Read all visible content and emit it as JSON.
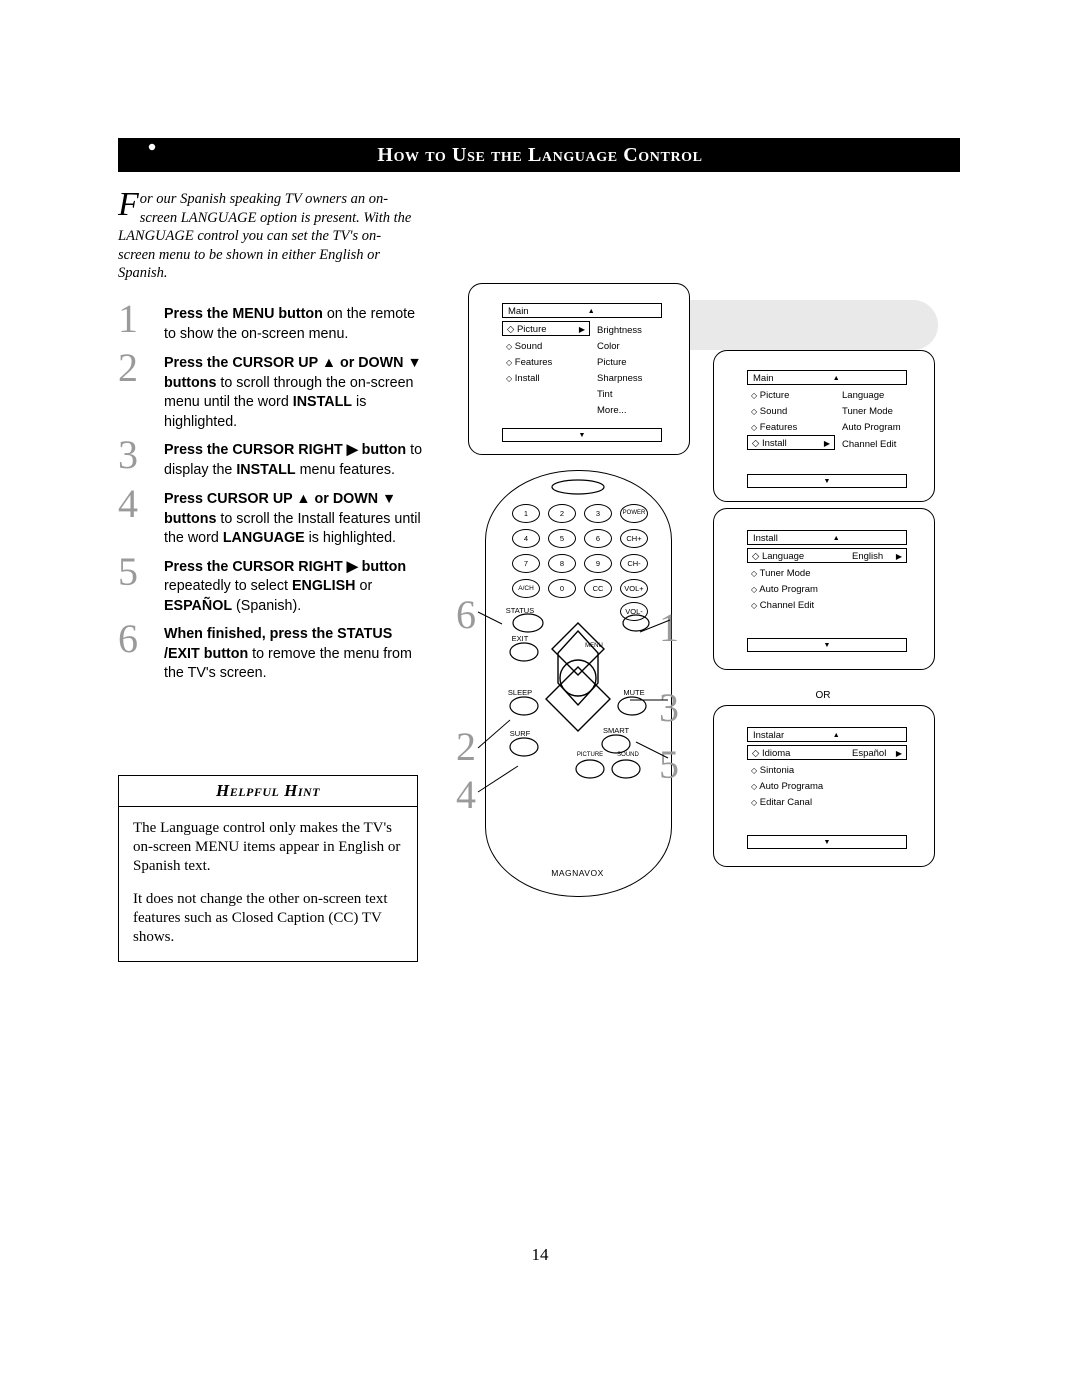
{
  "header": {
    "title": "How to Use the Language Control",
    "icon": "remote-control-icon"
  },
  "intro": {
    "dropcap": "F",
    "text": "or our Spanish speaking TV owners an on-screen LANGUAGE option is present. With the LANGUAGE control you can set the TV's on-screen menu to be shown in either English or Spanish."
  },
  "steps": [
    {
      "num": "1",
      "html": "<b>Press the MENU button</b> on the remote to show the on-screen menu."
    },
    {
      "num": "2",
      "html": "<b>Press the CURSOR UP ▲ or DOWN ▼ buttons</b> to scroll through the on-screen menu until the word <b>INSTALL</b> is highlighted."
    },
    {
      "num": "3",
      "html": "<b>Press the CURSOR RIGHT ▶ button</b> to display the <b>INSTALL</b> menu features."
    },
    {
      "num": "4",
      "html": "<b>Press CURSOR UP ▲ or DOWN ▼ buttons</b> to scroll the Install features until the word <b>LANGUAGE</b> is highlighted."
    },
    {
      "num": "5",
      "html": "<b>Press the CURSOR RIGHT ▶ button</b> repeatedly to select <b>ENGLISH</b> or <b>ESPAÑOL</b> (Spanish)."
    },
    {
      "num": "6",
      "html": "<b>When finished, press the STATUS /EXIT button</b> to remove the menu from the TV's screen."
    }
  ],
  "hint": {
    "title": "Helpful Hint",
    "paragraphs": [
      "The Language control only makes the TV's on-screen MENU items appear in English or Spanish text.",
      "It does not change the other on-screen text features such as Closed Caption (CC) TV shows."
    ]
  },
  "remote": {
    "brand": "MAGNAVOX",
    "keys": [
      {
        "label": "1"
      },
      {
        "label": "2"
      },
      {
        "label": "3"
      },
      {
        "label": "POWER"
      },
      {
        "label": "4"
      },
      {
        "label": "5"
      },
      {
        "label": "6"
      },
      {
        "label": "CH+"
      },
      {
        "label": "7"
      },
      {
        "label": "8"
      },
      {
        "label": "9"
      },
      {
        "label": "CH-"
      },
      {
        "label": "A/CH"
      },
      {
        "label": "0"
      },
      {
        "label": "CC"
      },
      {
        "label": "VOL+"
      },
      {
        "label": "STATUS"
      },
      {
        "label": "VOL-"
      },
      {
        "label": "EXIT"
      },
      {
        "label": "MENU"
      },
      {
        "label": "SLEEP"
      },
      {
        "label": "MUTE"
      },
      {
        "label": "SURF"
      },
      {
        "label": "SMART"
      },
      {
        "label": "PICTURE"
      },
      {
        "label": "SOUND"
      }
    ]
  },
  "callouts": [
    "6",
    "1",
    "3",
    "2",
    "5",
    "4"
  ],
  "osd": {
    "main_english": {
      "title": "Main",
      "left_items": [
        "Picture",
        "Sound",
        "Features",
        "Install"
      ],
      "highlight": "Picture",
      "right_items": [
        "Brightness",
        "Color",
        "Picture",
        "Sharpness",
        "Tint",
        "More..."
      ]
    },
    "main_install": {
      "title": "Main",
      "left_items": [
        "Picture",
        "Sound",
        "Features",
        "Install"
      ],
      "highlight": "Install",
      "right_items": [
        "Language",
        "Tuner Mode",
        "Auto Program",
        "Channel Edit"
      ]
    },
    "install_english": {
      "title": "Install",
      "highlight": "Language",
      "highlight_value": "English",
      "items": [
        "Tuner Mode",
        "Auto Program",
        "Channel Edit"
      ]
    },
    "install_spanish": {
      "title": "Instalar",
      "highlight": "Idioma",
      "highlight_value": "Español",
      "items": [
        "Sintonia",
        "Auto Programa",
        "Editar Canal"
      ]
    },
    "or_label": "OR"
  },
  "page_number": "14"
}
